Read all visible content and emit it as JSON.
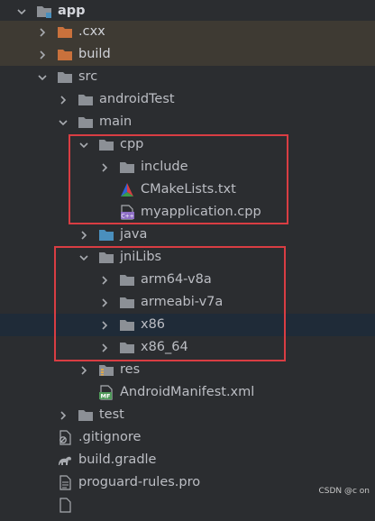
{
  "tree": {
    "items": [
      {
        "label": "app"
      },
      {
        "label": ".cxx"
      },
      {
        "label": "build"
      },
      {
        "label": "src"
      },
      {
        "label": "androidTest"
      },
      {
        "label": "main"
      },
      {
        "label": "cpp"
      },
      {
        "label": "include"
      },
      {
        "label": "CMakeLists.txt"
      },
      {
        "label": "myapplication.cpp"
      },
      {
        "label": "java"
      },
      {
        "label": "jniLibs"
      },
      {
        "label": "arm64-v8a"
      },
      {
        "label": "armeabi-v7a"
      },
      {
        "label": "x86"
      },
      {
        "label": "x86_64"
      },
      {
        "label": "res"
      },
      {
        "label": "AndroidManifest.xml"
      },
      {
        "label": "test"
      },
      {
        "label": ".gitignore"
      },
      {
        "label": "build.gradle"
      },
      {
        "label": "proguard-rules.pro"
      }
    ]
  },
  "icons": {
    "folder": "folder-icon",
    "folder_excluded": "excluded-folder-icon",
    "folder_source": "source-folder-icon",
    "folder_resources": "resources-folder-icon",
    "cmake": "cmake-icon",
    "cpp_file": "cpp-file-icon",
    "manifest": "manifest-icon",
    "gitignore": "gitignore-icon",
    "gradle": "gradle-icon",
    "text_file": "text-file-icon",
    "chevron_down": "chevron-down-icon",
    "chevron_right": "chevron-right-icon"
  },
  "colors": {
    "background": "#2b2d30",
    "excluded_row": "#3e3a33",
    "selected_row": "#1f2b38",
    "folder": "#8c9096",
    "excluded_folder": "#c9713c",
    "source_folder": "#4a8fbd",
    "highlight_box": "#d93d43"
  },
  "watermark": "CSDN @c on"
}
